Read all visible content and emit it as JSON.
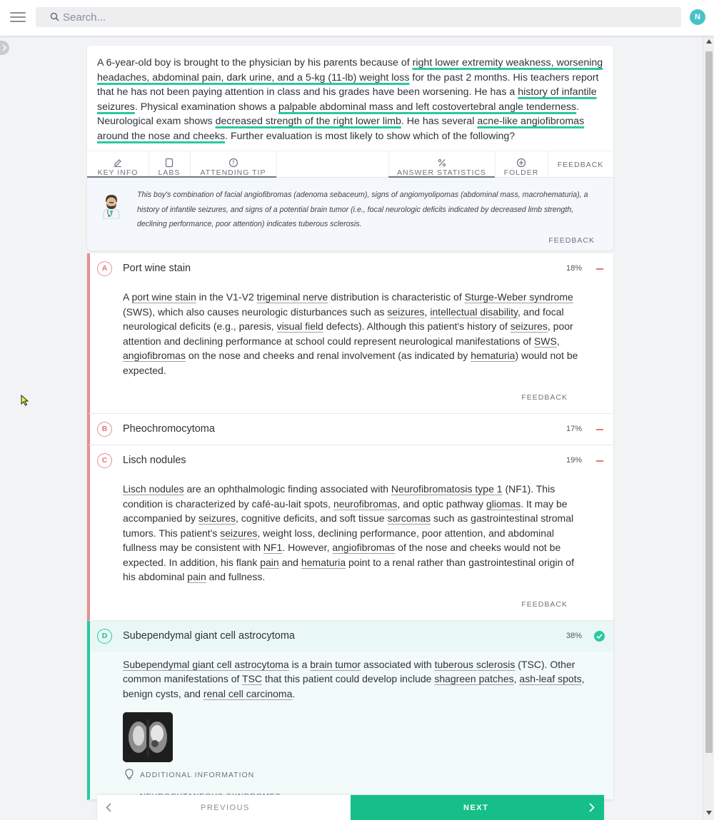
{
  "header": {
    "search_placeholder": "Search...",
    "avatar_initial": "N"
  },
  "question": {
    "segments": [
      {
        "t": "A 6-year-old boy is brought to the physician by his parents because of "
      },
      {
        "t": "right lower extremity weakness, worsening headaches, abdominal pain, dark urine, and a 5-kg (11-lb) weight loss",
        "hl": true
      },
      {
        "t": " for the past 2 months. His teachers report that he has not been paying attention in class and his grades have been worsening. He has a "
      },
      {
        "t": "history of infantile seizures",
        "hl": true
      },
      {
        "t": ". Physical examination shows a "
      },
      {
        "t": "palpable abdominal mass and left costovertebral angle tenderness",
        "hl": true
      },
      {
        "t": ". Neurological exam shows "
      },
      {
        "t": "decreased strength of the right lower limb",
        "hl": true
      },
      {
        "t": ". He has several "
      },
      {
        "t": "acne-like angiofibromas around the nose and cheeks",
        "hl": true
      },
      {
        "t": ". Further evaluation is most likely to show which of the following?"
      }
    ]
  },
  "tabs": {
    "key_info": "KEY INFO",
    "labs": "LABS",
    "attending_tip": "ATTENDING TIP",
    "answer_statistics": "ANSWER STATISTICS",
    "folder": "FOLDER",
    "feedback": "FEEDBACK"
  },
  "tip": {
    "text": "This boy's combination of facial angiofibromas (adenoma sebaceum), signs of angiomyolipomas (abdominal mass, macrohematuria), a history of infantile seizures, and signs of a potential brain tumor (i.e., focal neurologic deficits indicated by decreased limb strength, declining performance, poor attention) indicates tuberous sclerosis.",
    "feedback": "FEEDBACK"
  },
  "answers": [
    {
      "letter": "A",
      "title": "Port wine stain",
      "pct": "18%",
      "segments": [
        {
          "t": "A "
        },
        {
          "t": "port wine stain",
          "u": true
        },
        {
          "t": " in the V1-V2 "
        },
        {
          "t": "trigeminal nerve",
          "u": true
        },
        {
          "t": " distribution is characteristic of "
        },
        {
          "t": "Sturge-Weber syndrome",
          "u": true
        },
        {
          "t": " (SWS), which also causes neurologic disturbances such as "
        },
        {
          "t": "seizures",
          "u": true
        },
        {
          "t": ", "
        },
        {
          "t": "intellectual disability",
          "u": true
        },
        {
          "t": ", and focal neurological deficits (e.g., paresis, "
        },
        {
          "t": "visual field",
          "u": true
        },
        {
          "t": " defects). Although this patient's history of "
        },
        {
          "t": "seizures",
          "u": true
        },
        {
          "t": ", poor attention and declining performance at school could represent neurological manifestations of "
        },
        {
          "t": "SWS",
          "u": true
        },
        {
          "t": ", "
        },
        {
          "t": "angiofibromas",
          "u": true
        },
        {
          "t": " on the nose and cheeks and renal involvement (as indicated by "
        },
        {
          "t": "hematuria",
          "u": true
        },
        {
          "t": ") would not be expected."
        }
      ],
      "feedback": "FEEDBACK"
    },
    {
      "letter": "B",
      "title": "Pheochromocytoma",
      "pct": "17%"
    },
    {
      "letter": "C",
      "title": "Lisch nodules",
      "pct": "19%",
      "segments": [
        {
          "t": "Lisch nodules",
          "u": true
        },
        {
          "t": " are an ophthalmologic finding associated with "
        },
        {
          "t": "Neurofibromatosis type 1",
          "u": true
        },
        {
          "t": " (NF1). This condition is characterized by café-au-lait spots, "
        },
        {
          "t": "neurofibromas",
          "u": true
        },
        {
          "t": ", and optic pathway "
        },
        {
          "t": "gliomas",
          "u": true
        },
        {
          "t": ". It may be accompanied by "
        },
        {
          "t": "seizures",
          "u": true
        },
        {
          "t": ", cognitive deficits, and soft tissue "
        },
        {
          "t": "sarcomas",
          "u": true
        },
        {
          "t": " such as gastrointestinal stromal tumors. This patient's "
        },
        {
          "t": "seizures",
          "u": true
        },
        {
          "t": ", weight loss, declining performance, poor attention, and abdominal fullness may be consistent with "
        },
        {
          "t": "NF1",
          "u": true
        },
        {
          "t": ". However, "
        },
        {
          "t": "angiofibromas",
          "u": true
        },
        {
          "t": " of the nose and cheeks would not be expected. In addition, his flank "
        },
        {
          "t": "pain",
          "u": true
        },
        {
          "t": " and "
        },
        {
          "t": "hematuria",
          "u": true
        },
        {
          "t": " point to a renal rather than gastrointestinal origin of his abdominal "
        },
        {
          "t": "pain",
          "u": true
        },
        {
          "t": " and fullness."
        }
      ],
      "feedback": "FEEDBACK"
    },
    {
      "letter": "D",
      "title": "Subependymal giant cell astrocytoma",
      "pct": "38%",
      "segments": [
        {
          "t": "Subependymal giant cell astrocytoma",
          "u": true
        },
        {
          "t": " is a "
        },
        {
          "t": "brain tumor",
          "u": true
        },
        {
          "t": " associated with "
        },
        {
          "t": "tuberous sclerosis",
          "u": true
        },
        {
          "t": " (TSC). Other common manifestations of "
        },
        {
          "t": "TSC",
          "u": true
        },
        {
          "t": " that this patient could develop include "
        },
        {
          "t": "shagreen patches",
          "u": true
        },
        {
          "t": ", "
        },
        {
          "t": "ash-leaf spots",
          "u": true
        },
        {
          "t": ", benign cysts, and "
        },
        {
          "t": "renal cell carcinoma",
          "u": true
        },
        {
          "t": "."
        }
      ],
      "additional_info": "ADDITIONAL INFORMATION",
      "related_article": "NEUROCUTANEOUS SYNDROMES"
    }
  ],
  "nav": {
    "previous": "PREVIOUS",
    "next": "NEXT"
  }
}
